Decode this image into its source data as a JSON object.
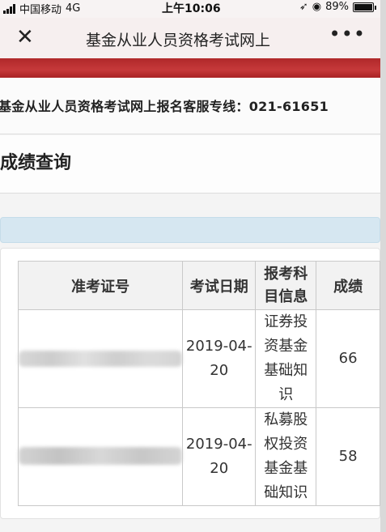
{
  "status_bar": {
    "carrier": "中国移动",
    "network": "4G",
    "time": "上午10:06",
    "battery": "89%"
  },
  "nav": {
    "close_icon": "close-icon",
    "title": "基金从业人员资格考试网上",
    "more_icon": "more-icon"
  },
  "hotline": "基金从业人员资格考试网上报名客服专线：021-61651",
  "page_heading": "成绩查询",
  "table": {
    "headers": [
      "准考证号",
      "考试日期",
      "报考科目信息",
      "成绩"
    ],
    "rows": [
      {
        "ticket": "",
        "date": "2019-04-20",
        "subject": "证券投资基金基础知识",
        "score": "66"
      },
      {
        "ticket": "",
        "date": "2019-04-20",
        "subject": "私募股权投资基金基础知识",
        "score": "58"
      }
    ]
  },
  "colors": {
    "accent_red": "#b9302f",
    "info_bar": "#d6e7f1"
  }
}
